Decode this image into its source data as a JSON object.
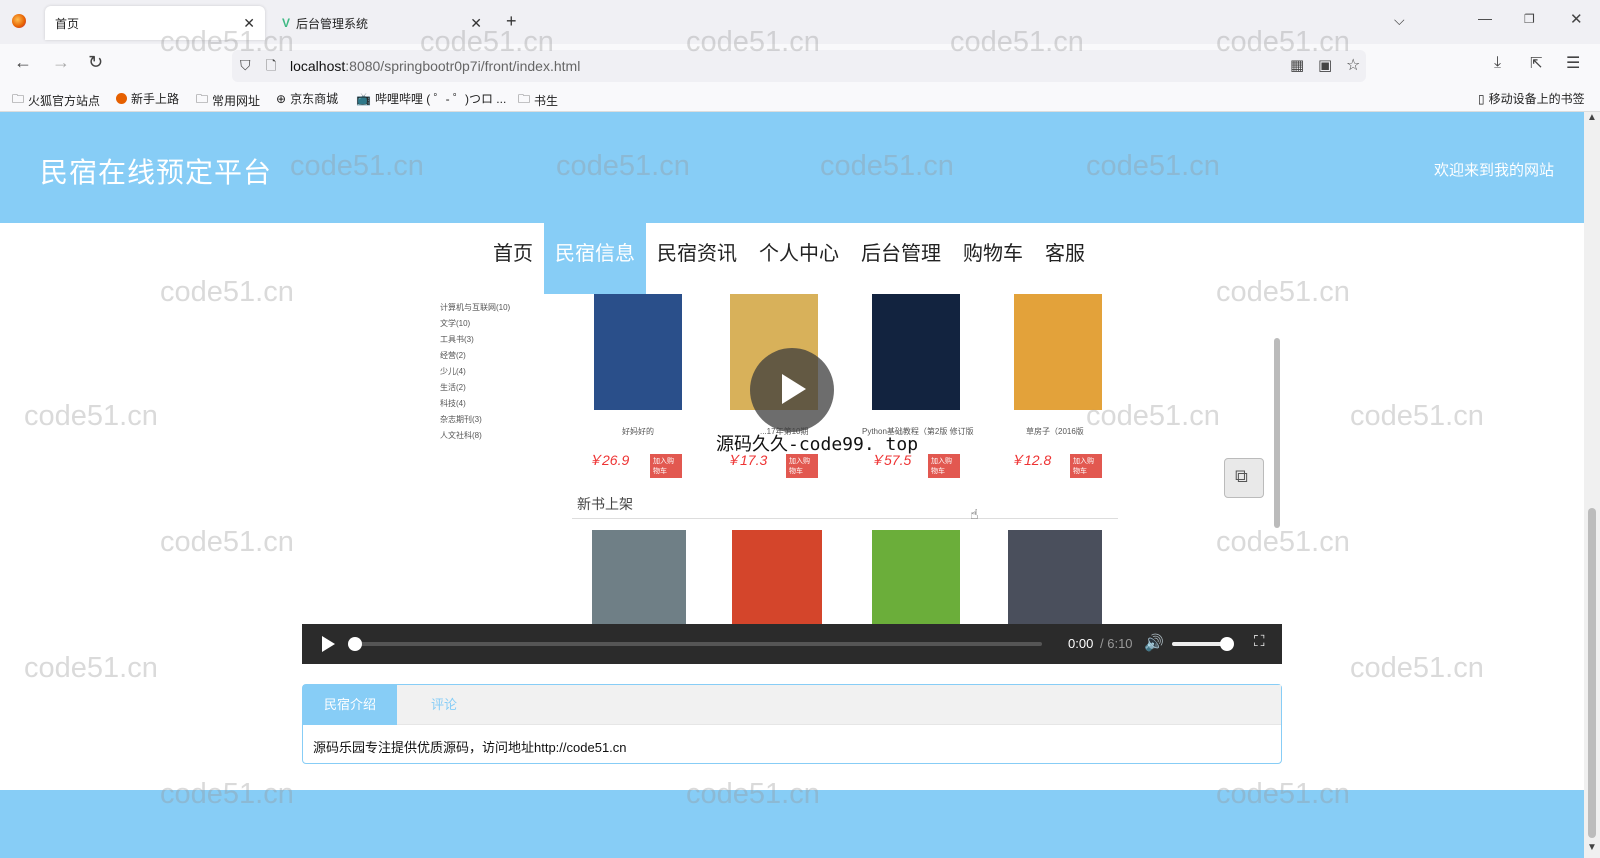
{
  "browser": {
    "tabs": [
      {
        "title": "首页",
        "active": true,
        "favicon": "firefox-icon"
      },
      {
        "title": "后台管理系统",
        "active": false,
        "favicon": "vue-icon"
      }
    ],
    "new_tab": "+",
    "url_host": "localhost",
    "url_path": ":8080/springbootr0p7i/front/index.html",
    "bookmarks": [
      "火狐官方站点",
      "新手上路",
      "常用网址",
      "京东商城",
      "哔哩哔哩 ( ゜- ゜)つロ ...",
      "书生"
    ],
    "mobile_bookmarks": "移动设备上的书签"
  },
  "site": {
    "title": "民宿在线预定平台",
    "welcome": "欢迎来到我的网站",
    "nav": [
      {
        "label": "首页",
        "active": false
      },
      {
        "label": "民宿信息",
        "active": true
      },
      {
        "label": "民宿资讯",
        "active": false
      },
      {
        "label": "个人中心",
        "active": false
      },
      {
        "label": "后台管理",
        "active": false
      },
      {
        "label": "购物车",
        "active": false
      },
      {
        "label": "客服",
        "active": false
      }
    ]
  },
  "video": {
    "categories": [
      "计算机与互联网(10)",
      "文学(10)",
      "工具书(3)",
      "经营(2)",
      "少儿(4)",
      "生活(2)",
      "科技(4)",
      "杂志期刊(3)",
      "人文社科(8)"
    ],
    "books": [
      {
        "name": "好妈好的",
        "price": "￥26.9",
        "cart": "加入购物车",
        "color": "#2a4f8a"
      },
      {
        "name": "...17年第10期",
        "price": "￥17.3",
        "cart": "加入购物车",
        "color": "#d8b15a"
      },
      {
        "name": "Python基础教程（第2版 修订版",
        "price": "￥57.5",
        "cart": "加入购物车",
        "color": "#12233f"
      },
      {
        "name": "草房子（2016版",
        "price": "￥12.8",
        "cart": "加入购物车",
        "color": "#e3a23a"
      }
    ],
    "section_title": "新书上架",
    "new_books": [
      {
        "color": "#6f7f86"
      },
      {
        "color": "#d4452b"
      },
      {
        "color": "#6bae3a"
      },
      {
        "color": "#4a4f5c"
      }
    ],
    "overlay_text": "源码久久-code99. top",
    "time_current": "0:00",
    "time_total": "/ 6:10"
  },
  "panel": {
    "tabs": [
      {
        "label": "民宿介绍",
        "active": true
      },
      {
        "label": "评论",
        "active": false
      }
    ],
    "content": "源码乐园专注提供优质源码，访问地址http://code51.cn"
  },
  "watermark": "code51.cn",
  "colors": {
    "accent": "#87cdf6",
    "price": "#e33333",
    "cart": "#e25850"
  }
}
